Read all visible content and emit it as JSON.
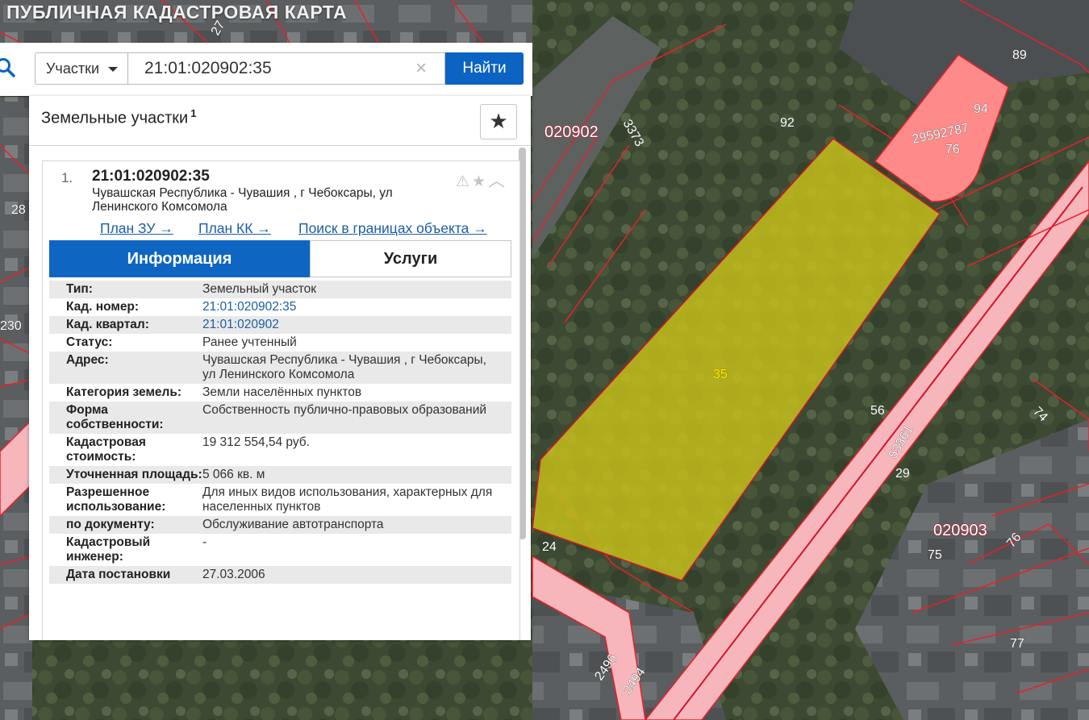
{
  "app": {
    "title": "ПУБЛИЧНАЯ КАДАСТРОВАЯ КАРТА"
  },
  "search": {
    "type_label": "Участки",
    "query": "21:01:020902:35",
    "button_label": "Найти"
  },
  "panel": {
    "title": "Земельные участки",
    "count": "1",
    "item": {
      "number": "1.",
      "cadastral_number": "21:01:020902:35",
      "address": "Чувашская Республика - Чувашия , г Чебоксары, ул Ленинского Комсомола",
      "links": {
        "plan_zu": "План ЗУ →",
        "plan_kk": "План КК →",
        "search_bounds": "Поиск в границах объекта →"
      },
      "tabs": {
        "info": "Информация",
        "services": "Услуги"
      },
      "info_rows": [
        {
          "label": "Тип:",
          "value": "Земельный участок",
          "link": false
        },
        {
          "label": "Кад. номер:",
          "value": "21:01:020902:35",
          "link": true
        },
        {
          "label": "Кад. квартал:",
          "value": "21:01:020902",
          "link": true
        },
        {
          "label": "Статус:",
          "value": "Ранее учтенный",
          "link": false
        },
        {
          "label": "Адрес:",
          "value": "Чувашская Республика - Чувашия , г Чебоксары, ул Ленинского Комсомола",
          "link": false
        },
        {
          "label": "Категория земель:",
          "value": "Земли населённых пунктов",
          "link": false
        },
        {
          "label": "Форма собственности:",
          "value": "Собственность публично-правовых образований",
          "link": false
        },
        {
          "label": "Кадастровая стоимость:",
          "value": "19 312 554,54 руб.",
          "link": false
        },
        {
          "label": "Уточненная площадь:",
          "value": "5 066 кв. м",
          "link": false
        },
        {
          "label": "Разрешенное использование:",
          "value": "Для иных видов использования, характерных для населенных пунктов",
          "link": false
        },
        {
          "label": "по документу:",
          "value": "Обслуживание автотранспорта",
          "link": false
        },
        {
          "label": "Кадастровый инженер:",
          "value": "-",
          "link": false
        },
        {
          "label": "Дата постановки",
          "value": "27.03.2006",
          "link": false
        }
      ]
    }
  },
  "map": {
    "labels": {
      "quarter_020902": "020902",
      "quarter_020903": "020903",
      "parcel_35": "35",
      "parcel_92": "92",
      "parcel_94": "94",
      "parcel_89": "89",
      "parcel_29592787": "29592787",
      "parcel_76": "76",
      "parcel_56": "56",
      "parcel_29": "29",
      "parcel_24": "24",
      "parcel_74": "74",
      "parcel_76b": "76",
      "parcel_75": "75",
      "parcel_77": "77",
      "parcel_3373": "3373",
      "parcel_53361": "53361",
      "parcel_2496": "2496",
      "parcel_2494": "2494",
      "parcel_230": "230",
      "parcel_28": "28",
      "parcel_27": "27"
    },
    "colors": {
      "selected_parcel": "#c8c21a",
      "boundary": "#e8202a",
      "highlight_parcel": "#ff8a8a",
      "road": "#f6b6bb"
    }
  }
}
